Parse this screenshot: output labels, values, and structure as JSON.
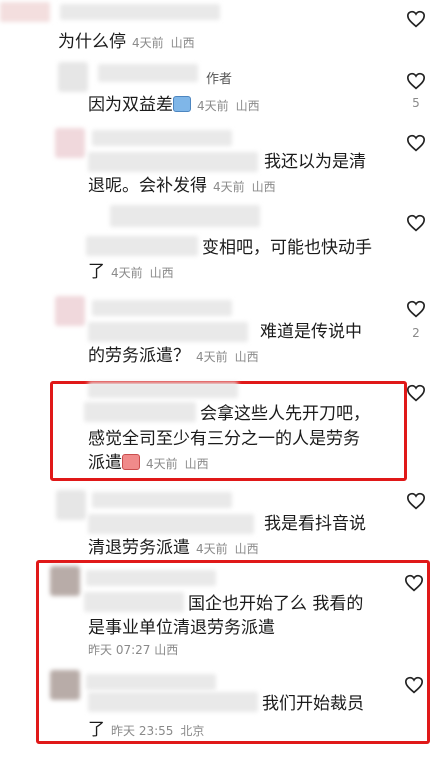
{
  "comments": [
    {
      "text": "为什么停",
      "time": "4天前",
      "location": "山西",
      "likes": ""
    },
    {
      "author_tag": "作者",
      "text": "因为双益差",
      "time": "4天前",
      "location": "山西",
      "likes": "5"
    },
    {
      "line1": "我还以为是清",
      "line2": "退呢。会补发得",
      "time": "4天前",
      "location": "山西",
      "likes": ""
    },
    {
      "line1": "变相吧，可能也快动手",
      "line2": "了",
      "time": "4天前",
      "location": "山西",
      "likes": ""
    },
    {
      "line1": "难道是传说中",
      "line2": "的劳务派遣？",
      "time": "4天前",
      "location": "山西",
      "likes": "2"
    },
    {
      "line1": "会拿这些人先开刀吧，",
      "line2": "感觉全司至少有三分之一的人是劳务",
      "line3": "派遣",
      "time": "4天前",
      "location": "山西",
      "likes": ""
    },
    {
      "line1": "我是看抖音说",
      "line2": "清退劳务派遣",
      "time": "4天前",
      "location": "山西",
      "likes": ""
    },
    {
      "line1": "国企也开始了么 我看的",
      "line2": "是事业单位清退劳务派遣",
      "time": "昨天 07:27",
      "location": "山西",
      "likes": ""
    },
    {
      "line1": "我们开始裁员",
      "line2": "了",
      "time": "昨天 23:55",
      "location": "北京",
      "likes": ""
    }
  ],
  "icons": {
    "like": "heart-outline-icon",
    "emoji_laugh": "laughing-emoji-icon",
    "emoji_cry": "crying-emoji-icon"
  },
  "colors": {
    "highlight": "#e01818",
    "meta": "#8a8a8a"
  }
}
